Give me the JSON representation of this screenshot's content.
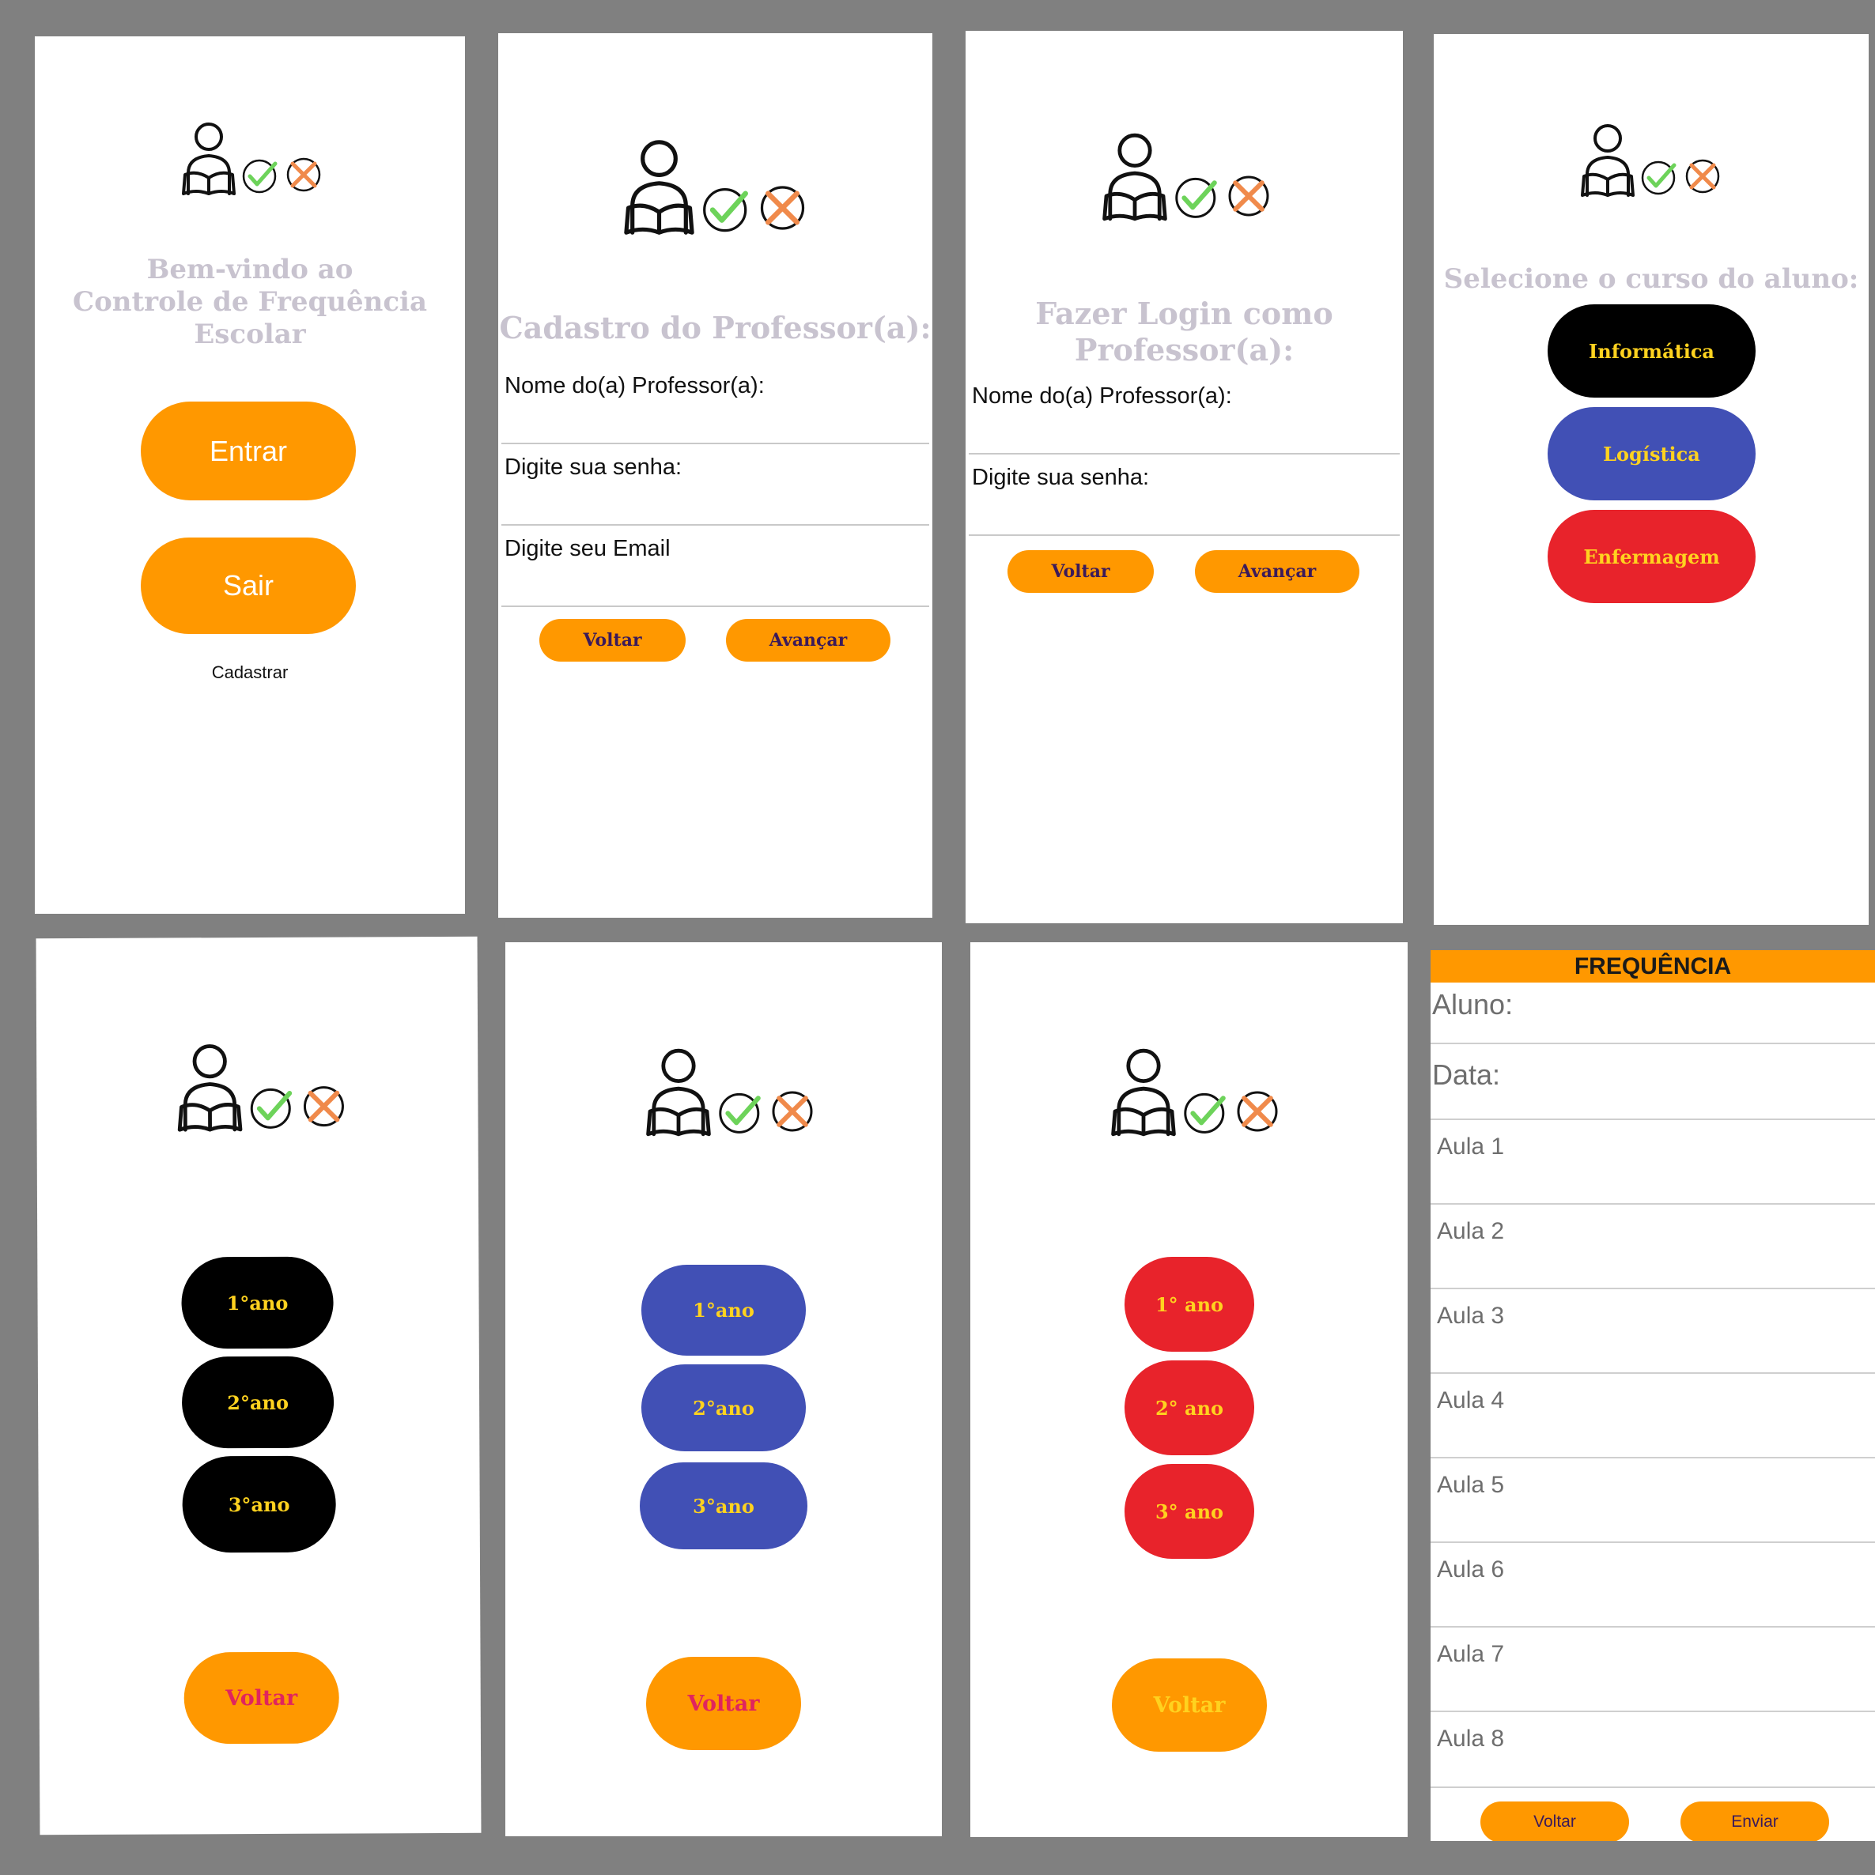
{
  "screens": {
    "welcome": {
      "title": "Bem-vindo ao\nControle de Frequência\nEscolar",
      "enter_label": "Entrar",
      "exit_label": "Sair",
      "register_link": "Cadastrar"
    },
    "register": {
      "title": "Cadastro do Professor(a):",
      "name_label": "Nome do(a) Professor(a):",
      "password_label": "Digite sua senha:",
      "email_label": "Digite seu Email",
      "back_label": "Voltar",
      "next_label": "Avançar"
    },
    "login": {
      "title": "Fazer Login como\nProfessor(a):",
      "name_label": "Nome do(a) Professor(a):",
      "password_label": "Digite sua senha:",
      "back_label": "Voltar",
      "next_label": "Avançar"
    },
    "courses": {
      "title": "Selecione o curso do aluno:",
      "items": [
        {
          "label": "Informática",
          "color": "#000000"
        },
        {
          "label": "Logística",
          "color": "#4150b5"
        },
        {
          "label": "Enfermagem",
          "color": "#e8232b"
        }
      ]
    },
    "years_informatica": {
      "color": "#000000",
      "years": [
        "1°ano",
        "2°ano",
        "3°ano"
      ],
      "back_label": "Voltar"
    },
    "years_logistica": {
      "color": "#4150b5",
      "years": [
        "1°ano",
        "2°ano",
        "3°ano"
      ],
      "back_label": "Voltar"
    },
    "years_enfermagem": {
      "color": "#e8232b",
      "years": [
        "1° ano",
        "2° ano",
        "3° ano"
      ],
      "back_label": "Voltar"
    },
    "attendance": {
      "header": "FREQUÊNCIA",
      "student_label": "Aluno:",
      "date_label": "Data:",
      "lessons": [
        "Aula 1",
        "Aula 2",
        "Aula 3",
        "Aula 4",
        "Aula 5",
        "Aula 6",
        "Aula 7",
        "Aula 8"
      ],
      "back_label": "Voltar",
      "send_label": "Enviar"
    }
  },
  "colors": {
    "accent": "#ff9800",
    "title_gray": "#c8c3cf",
    "check_green": "#6dd35a",
    "cross_orange": "#f08a4b",
    "pink_text": "#e0245e",
    "yellow_text": "#ffd21f"
  },
  "icons": [
    "reader-icon",
    "check-icon",
    "cross-icon"
  ]
}
